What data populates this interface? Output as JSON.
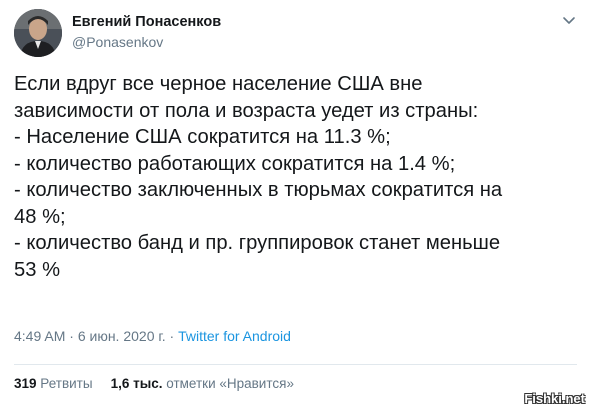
{
  "author": {
    "name": "Евгений Понасенков",
    "handle": "@Ponasenkov",
    "avatar_icon": "avatar-photo"
  },
  "tweet_lines": [
    "Если вдруг все черное население США вне",
    "зависимости от пола и возраста уедет из страны:",
    "- Население США сократится на 11.3 %;",
    "- количество работающих сократится на 1.4 %;",
    "- количество заключенных в тюрьмах сократится на",
    "48 %;",
    "- количество банд и пр. группировок станет меньше",
    "53 %"
  ],
  "meta": {
    "time": "4:49 AM",
    "separator": " · ",
    "date": "6 июн. 2020 г.",
    "source": "Twitter for Android"
  },
  "stats": {
    "retweets_count": "319",
    "retweets_label": "Ретвиты",
    "likes_count": "1,6 тыс.",
    "likes_label": "отметки «Нравится»"
  },
  "watermark": "Fishki.net",
  "colors": {
    "text": "#14171a",
    "secondary": "#657786",
    "link": "#1b95e0",
    "divider": "#e1e8ed"
  },
  "icons": {
    "menu": "chevron-down-icon"
  }
}
